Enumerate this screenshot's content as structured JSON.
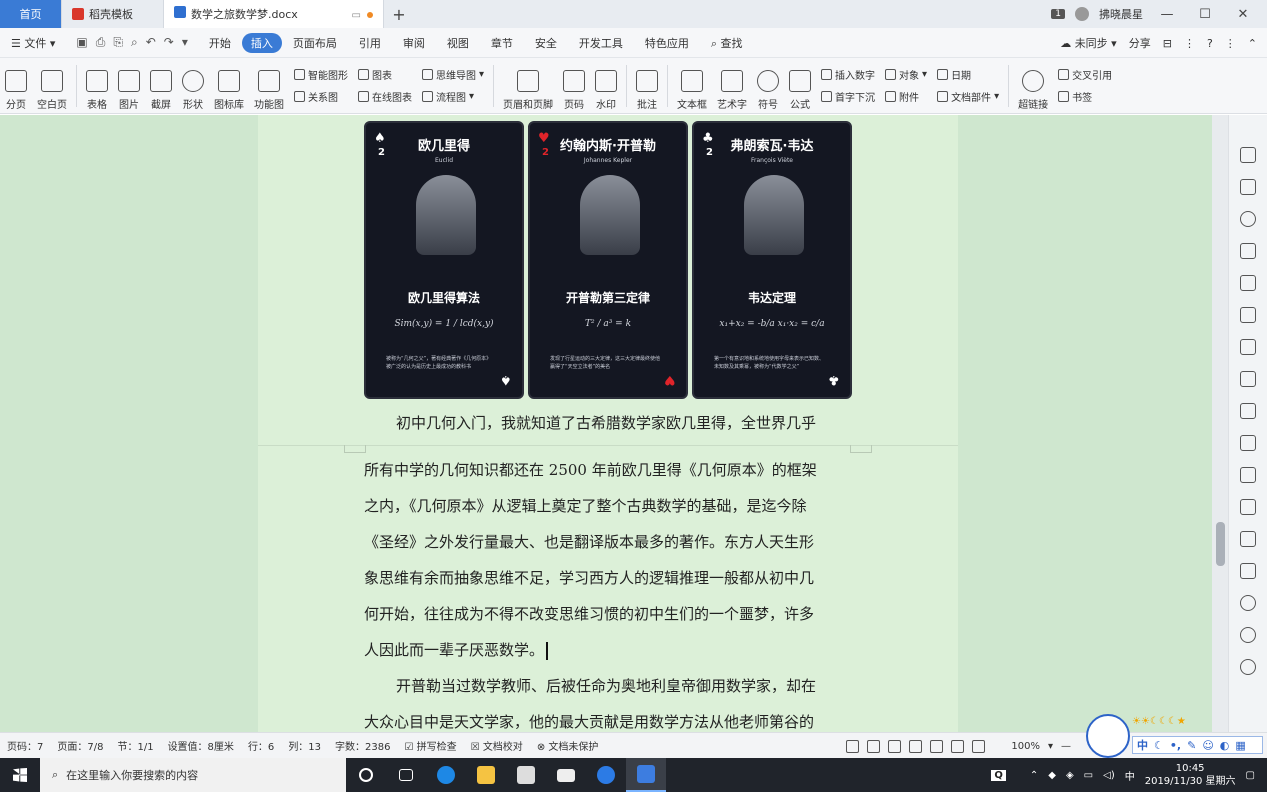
{
  "tabs": {
    "home": "首页",
    "templates": "稻壳模板",
    "doc": "数学之旅数学梦.docx"
  },
  "titlebar": {
    "badge": "1",
    "user": "拂晓晨星",
    "min": "—",
    "max": "☐",
    "close": "✕"
  },
  "menu": {
    "file": "文件",
    "items": [
      "开始",
      "插入",
      "页面布局",
      "引用",
      "审阅",
      "视图",
      "章节",
      "安全",
      "开发工具",
      "特色应用"
    ],
    "active_index": 1,
    "search": "查找",
    "sync": "未同步",
    "share": "分享"
  },
  "ribbon": {
    "big1": [
      "分页",
      "空白页",
      "表格",
      "图片",
      "截屏",
      "形状",
      "图标库",
      "功能图"
    ],
    "col1": [
      "智能图形",
      "关系图"
    ],
    "col2": [
      "图表",
      "在线图表"
    ],
    "col3": [
      "思维导图",
      "流程图"
    ],
    "big2": [
      "页眉和页脚",
      "页码",
      "水印",
      "批注",
      "文本框",
      "艺术字",
      "符号",
      "公式"
    ],
    "col4": [
      "插入数字",
      "首字下沉"
    ],
    "col5": [
      "对象",
      "附件"
    ],
    "col6": [
      "日期",
      "文档部件"
    ],
    "big3": [
      "超链接"
    ],
    "col7": [
      "交叉引用",
      "书签"
    ]
  },
  "cards": [
    {
      "rank": "2",
      "suit": "♠",
      "suit_color": "#ffffff",
      "name": "欧几里得",
      "latin": "Euclid",
      "theorem": "欧几里得算法",
      "formula": "Sim(x,y) = 1 / lcd(x,y)",
      "desc": "被称为“几何之父”，著有经典著作《几何原本》被广泛的认为是历史上最成功的教科书"
    },
    {
      "rank": "2",
      "suit": "♥",
      "suit_color": "#e0242a",
      "name": "约翰内斯·开普勒",
      "latin": "Johannes Kepler",
      "theorem": "开普勒第三定律",
      "formula": "T² / a³ = k",
      "desc": "发现了行星运动的三大定律，这三大定律最终使他赢得了“天空立法者”的美名"
    },
    {
      "rank": "2",
      "suit": "♣",
      "suit_color": "#ffffff",
      "name": "弗朗索瓦·韦达",
      "latin": "François Viète",
      "theorem": "韦达定理",
      "formula": "x₁+x₂ = -b/a    x₁·x₂ = c/a",
      "desc": "第一个有意识地和系统地使用字母来表示已知数、未知数及其乘幂，被称为“代数学之父”"
    }
  ],
  "text": {
    "p1_line1": "初中几何入门，我就知道了古希腊数学家欧几里得，全世界几乎",
    "p1_rest": [
      "所有中学的几何知识都还在 2500 年前欧几里得《几何原本》的框架",
      "之内，《几何原本》从逻辑上奠定了整个古典数学的基础，是迄今除",
      "《圣经》之外发行量最大、也是翻译版本最多的著作。东方人天生形",
      "象思维有余而抽象思维不足，学习西方人的逻辑推理一般都从初中几",
      "何开始，往往成为不得不改变思维习惯的初中生们的一个噩梦，许多",
      "人因此而一辈子厌恶数学。"
    ],
    "p2_line1": "开普勒当过数学教师、后被任命为奥地利皇帝御用数学家，却在",
    "p2_line2": "大众心目中是天文学家，他的最大贡献是用数学方法从他老师第谷的"
  },
  "status": {
    "page_no": "页码：7",
    "page": "页面：7/8",
    "section": "节：1/1",
    "setting": "设置值：8厘米",
    "row": "行：6",
    "col": "列：13",
    "words": "字数：2386",
    "spell": "拼写检查",
    "proof": "文档校对",
    "protect": "文档未保护",
    "zoom": "100%"
  },
  "ime": {
    "lang": "中",
    "weather": "☀☀☾☾☾★"
  },
  "taskbar": {
    "search_placeholder": "在这里输入你要搜索的内容",
    "ime": "中",
    "time": "10:45",
    "date": "2019/11/30 星期六"
  },
  "colors": {
    "accent": "#3a7bd5",
    "page_bg": "#dcf0d8",
    "workspace_bg": "#cfe7cf",
    "taskbar": "#20242b"
  }
}
